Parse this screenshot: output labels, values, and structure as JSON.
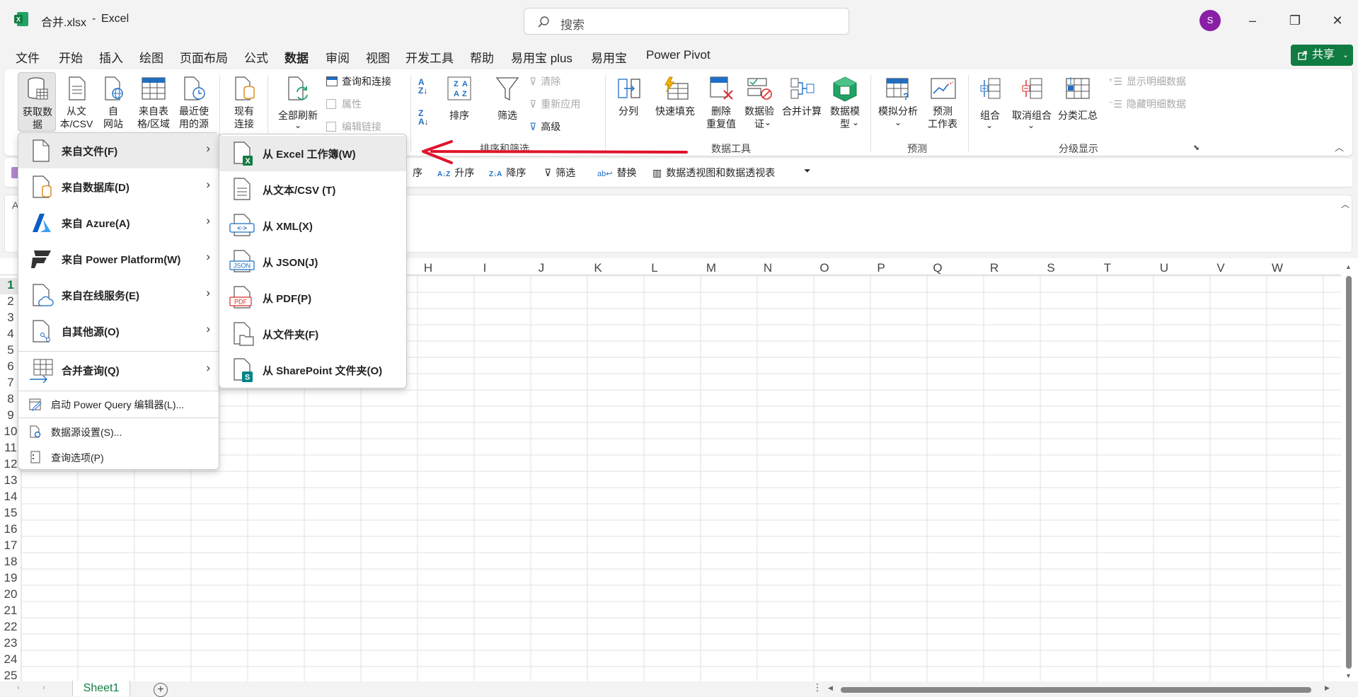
{
  "window": {
    "file_title": "合并.xlsx",
    "separator": "-",
    "app_name": "Excel"
  },
  "search": {
    "placeholder": "搜索"
  },
  "account": {
    "avatar_initial": "S"
  },
  "window_controls": {
    "minimize": "–",
    "restore": "❐",
    "close": "✕"
  },
  "tabs": [
    "文件",
    "开始",
    "插入",
    "绘图",
    "页面布局",
    "公式",
    "数据",
    "审阅",
    "视图",
    "开发工具",
    "帮助",
    "易用宝 plus",
    "易用宝",
    "Power Pivot"
  ],
  "active_tab": "数据",
  "share": {
    "label": "共享"
  },
  "ribbon": {
    "get_data": "获取数\n据",
    "from_text_csv": "从文\n本/CSV",
    "from_web": "自\n网站",
    "from_table": "来自表\n格/区域",
    "recent_sources": "最近使\n用的源",
    "existing_connections": "现有\n连接",
    "refresh_all": "全部刷新",
    "queries_connections": "查询和连接",
    "properties": "属性",
    "edit_links": "编辑链接",
    "sort": "排序",
    "filter": "筛选",
    "clear": "清除",
    "reapply": "重新应用",
    "advanced": "高级",
    "group_sort_filter": "排序和筛选",
    "text_to_columns": "分列",
    "flash_fill": "快速填充",
    "remove_duplicates": "删除\n重复值",
    "data_validation": "数据验\n证",
    "consolidate": "合并计算",
    "data_model": "数据模\n型",
    "group_data_tools": "数据工具",
    "what_if": "模拟分析",
    "forecast_sheet": "预测\n工作表",
    "group_forecast": "预测",
    "group": "组合",
    "ungroup": "取消组合",
    "subtotal": "分类汇总",
    "show_detail": "显示明细数据",
    "hide_detail": "隐藏明细数据",
    "group_outline": "分级显示"
  },
  "quick_bar": {
    "sort_partial": "序",
    "sort_asc": "升序",
    "sort_desc": "降序",
    "filter": "筛选",
    "replace": "替换",
    "pivot": "数据透视图和数据透视表"
  },
  "formula_area": {
    "name_box_partial": "A"
  },
  "columns": [
    "H",
    "I",
    "J",
    "K",
    "L",
    "M",
    "N",
    "O",
    "P",
    "Q",
    "R",
    "S",
    "T",
    "U",
    "V",
    "W"
  ],
  "rows": [
    "1",
    "2",
    "3",
    "4",
    "5",
    "6",
    "7",
    "8",
    "9",
    "10",
    "11",
    "12",
    "13",
    "14",
    "15",
    "16",
    "17",
    "18",
    "19",
    "20",
    "21",
    "22",
    "23",
    "24",
    "25"
  ],
  "sheet_tabs": {
    "sheet1": "Sheet1",
    "add": "+"
  },
  "get_data_menu": {
    "items": [
      {
        "label": "来自文件(F)",
        "icon": "file-icon"
      },
      {
        "label": "来自数据库(D)",
        "icon": "database-icon"
      },
      {
        "label": "来自 Azure(A)",
        "icon": "azure-icon"
      },
      {
        "label": "来自 Power Platform(W)",
        "icon": "power-platform-icon"
      },
      {
        "label": "来自在线服务(E)",
        "icon": "cloud-icon"
      },
      {
        "label": "自其他源(O)",
        "icon": "other-source-icon"
      },
      {
        "label": "合并查询(Q)",
        "icon": "combine-icon"
      }
    ],
    "launch_pq": "启动 Power Query 编辑器(L)...",
    "data_source_settings": "数据源设置(S)...",
    "query_options": "查询选项(P)"
  },
  "from_file_submenu": {
    "items": [
      {
        "label": "从 Excel 工作簿(W)",
        "icon": "excel-workbook-icon"
      },
      {
        "label": "从文本/CSV (T)",
        "icon": "text-file-icon"
      },
      {
        "label": "从 XML(X)",
        "icon": "xml-icon"
      },
      {
        "label": "从 JSON(J)",
        "icon": "json-icon"
      },
      {
        "label": "从 PDF(P)",
        "icon": "pdf-icon"
      },
      {
        "label": "从文件夹(F)",
        "icon": "folder-icon"
      },
      {
        "label": "从 SharePoint 文件夹(O)",
        "icon": "sharepoint-icon"
      }
    ]
  },
  "colors": {
    "excel_green": "#107c41",
    "arrow_red": "#e0142b",
    "avatar": "#8a1fa6"
  }
}
